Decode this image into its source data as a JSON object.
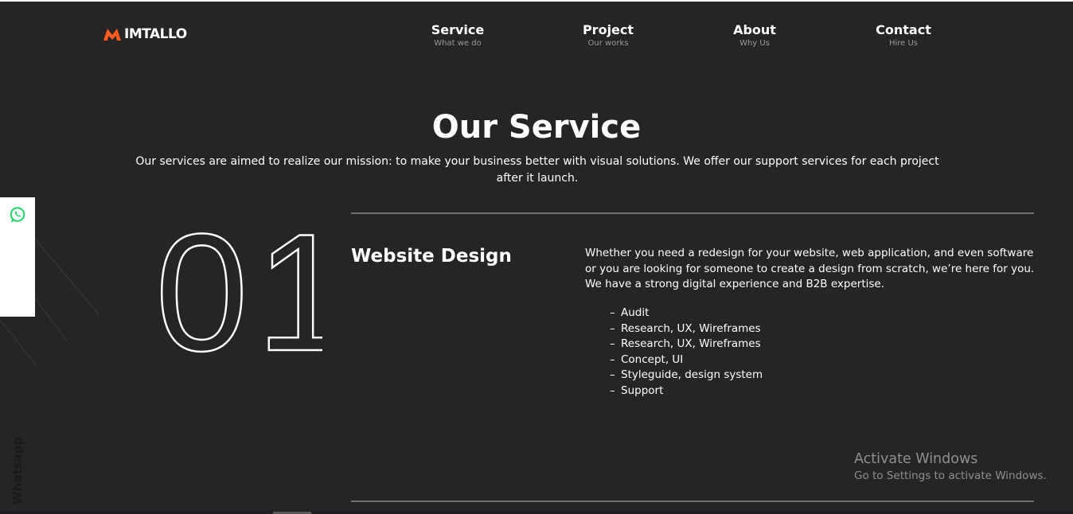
{
  "brand": {
    "name": "IMTALLO",
    "accent_color": "#ff5a1f",
    "logo_icon": "m-chevron-icon"
  },
  "nav": [
    {
      "id": "service",
      "label": "Service",
      "sub": "What we do"
    },
    {
      "id": "project",
      "label": "Project",
      "sub": "Our works"
    },
    {
      "id": "about",
      "label": "About",
      "sub": "Why Us"
    },
    {
      "id": "contact",
      "label": "Contact",
      "sub": "Hire Us"
    }
  ],
  "hero": {
    "title": "Our Service",
    "intro": "Our services are aimed to realize our mission: to make your business better with visual solutions. We offer our support services for each project after it launch."
  },
  "service": {
    "number": "01",
    "title": "Website Design",
    "description": "Whether you need a redesign for your website, web application, and even software or you are looking for someone to create a design from scratch, we’re here for you. We have a strong digital experience and B2B expertise.",
    "items": [
      "Audit",
      "Research, UX, Wireframes",
      "Research, UX, Wireframes",
      "Concept, UI",
      "Styleguide, design system",
      "Support"
    ]
  },
  "whatsapp": {
    "label": "Whatsapp",
    "icon": "whatsapp-icon",
    "color": "#25d366"
  },
  "watermark": {
    "title": "Activate Windows",
    "subtitle": "Go to Settings to activate Windows."
  },
  "colors": {
    "background": "#252525",
    "text": "#ffffff",
    "muted": "#9a9a9a",
    "divider": "#6e6e6e"
  }
}
